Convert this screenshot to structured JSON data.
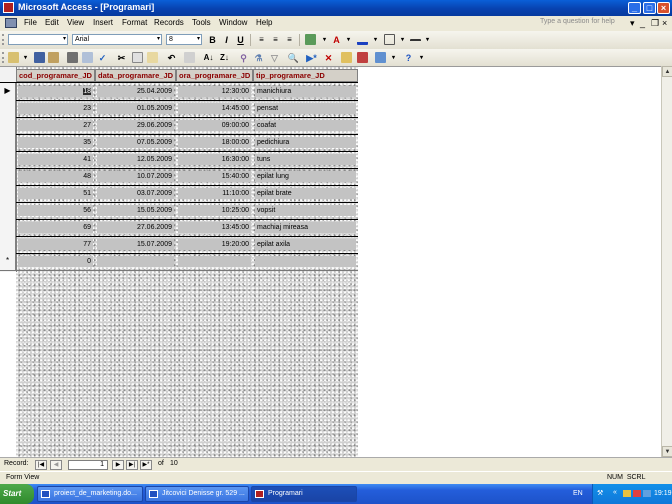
{
  "window": {
    "title": "Microsoft Access - [Programari]"
  },
  "menu": {
    "items": [
      "File",
      "Edit",
      "View",
      "Insert",
      "Format",
      "Records",
      "Tools",
      "Window",
      "Help"
    ],
    "help_placeholder": "Type a question for help"
  },
  "formatting": {
    "font": "Arial",
    "size": "8"
  },
  "table": {
    "columns": [
      "cod_programare_JD",
      "data_programare_JD",
      "ora_programare_JD",
      "tip_programare_JD"
    ],
    "rows": [
      [
        "18",
        "25.04.2009",
        "12:30:00",
        "manichiura"
      ],
      [
        "23",
        "01.05.2009",
        "14:45:00",
        "pensat"
      ],
      [
        "27",
        "29.06.2009",
        "09:00:00",
        "coafat"
      ],
      [
        "35",
        "07.05.2009",
        "18:00:00",
        "pedichiura"
      ],
      [
        "41",
        "12.05.2009",
        "16:30:00",
        "tuns"
      ],
      [
        "48",
        "10.07.2009",
        "15:40:00",
        "epilat lung"
      ],
      [
        "51",
        "03.07.2009",
        "11:10:00",
        "epilat brate"
      ],
      [
        "56",
        "15.05.2009",
        "10:25:00",
        "vopsit"
      ],
      [
        "69",
        "27.06.2009",
        "13:45:00",
        "machiaj mireasa"
      ],
      [
        "77",
        "15.07.2009",
        "19:20:00",
        "epilat axila"
      ]
    ],
    "new_row": {
      "marker": "*",
      "default_cod": "0"
    },
    "current_marker": "▶"
  },
  "navigator": {
    "label": "Record:",
    "current": "1",
    "of_label": "of",
    "total": "10"
  },
  "status": {
    "left": "Form View",
    "right": "NUM  SCRL"
  },
  "taskbar": {
    "start_label": "Start",
    "buttons": [
      "proiect_de_marketing.do...",
      "Jitcovici Denisse gr. 529 ...",
      "Programari"
    ],
    "language": "EN",
    "clock": "19:19"
  },
  "colors": {
    "title_bar": "#0842b0",
    "header_text": "#8b0000",
    "taskbar": "#245edb"
  }
}
